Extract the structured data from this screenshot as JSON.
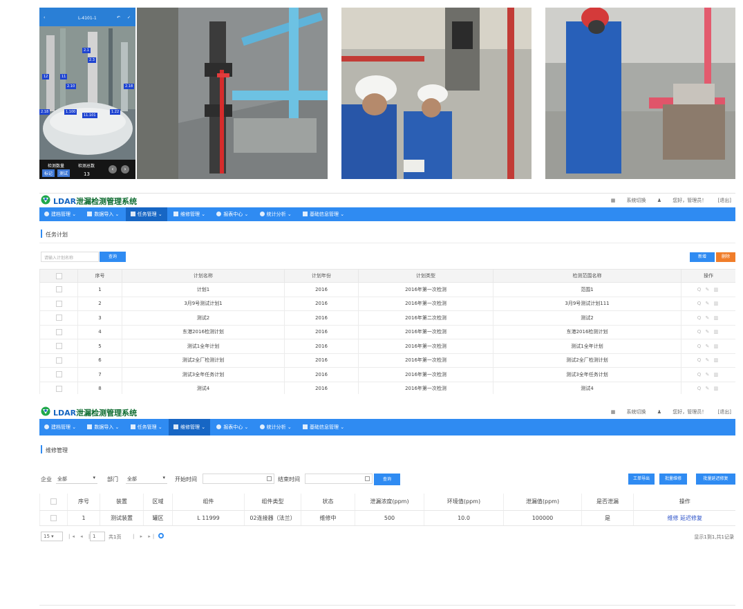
{
  "phone": {
    "title": "L-4101-1",
    "label_leak_count": "检测数量",
    "label_detected": "检测总数",
    "detected_value": "13",
    "btn_a": "标记",
    "btn_b": "测试"
  },
  "app1": {
    "brand_main": "LDAR",
    "brand_sub": "泄漏检测管理系统",
    "header_right": {
      "switch": "系统切换",
      "greeting": "您好，管理员！",
      "logout": "[退出]"
    },
    "nav": [
      "建档管理",
      "数据导入",
      "任务管理",
      "维修管理",
      "报表中心",
      "统计分析",
      "基础信息管理"
    ],
    "breadcrumb": "任务计划",
    "search_placeholder": "请输入计划名称",
    "search_button": "查询",
    "add_button": "新增",
    "delete_button": "删除",
    "columns": [
      "序号",
      "计划名称",
      "计划年份",
      "计划类型",
      "检测范围名称",
      "操作"
    ],
    "rows": [
      {
        "no": "1",
        "name": "计划1",
        "year": "2016",
        "type": "2016年第一次检测",
        "scope": "范围1"
      },
      {
        "no": "2",
        "name": "3月9号测试计划1",
        "year": "2016",
        "type": "2016年第一次检测",
        "scope": "3月9号测试计划111"
      },
      {
        "no": "3",
        "name": "测试2",
        "year": "2016",
        "type": "2016年第二次检测",
        "scope": "测试2"
      },
      {
        "no": "4",
        "name": "东港2016检测计划",
        "year": "2016",
        "type": "2016年第一次检测",
        "scope": "东港2016检测计划"
      },
      {
        "no": "5",
        "name": "测试1全年计划",
        "year": "2016",
        "type": "2016年第一次检测",
        "scope": "测试1全年计划"
      },
      {
        "no": "6",
        "name": "测试2全厂检测计划",
        "year": "2016",
        "type": "2016年第一次检测",
        "scope": "测试2全厂检测计划"
      },
      {
        "no": "7",
        "name": "测试3全年任务计划",
        "year": "2016",
        "type": "2016年第一次检测",
        "scope": "测试3全年任务计划"
      },
      {
        "no": "8",
        "name": "测试4",
        "year": "2016",
        "type": "2016年第一次检测",
        "scope": "测试4"
      }
    ],
    "ops_glyphs": "Q ✎ ▥"
  },
  "app2": {
    "brand_main": "LDAR",
    "brand_sub": "泄漏检测管理系统",
    "header_right": {
      "switch": "系统切换",
      "greeting": "您好，管理员！",
      "logout": "[退出]"
    },
    "nav": [
      "建档管理",
      "数据导入",
      "任务管理",
      "维修管理",
      "报表中心",
      "统计分析",
      "基础信息管理"
    ],
    "breadcrumb": "维修管理",
    "filters": {
      "company_label": "企业",
      "company_value": "全部",
      "dept_label": "部门",
      "dept_value": "全部",
      "start_label": "开始时间",
      "end_label": "结束时间",
      "query_button": "查询"
    },
    "right_buttons": [
      "工单导出",
      "批量维修",
      "批量延迟修复"
    ],
    "columns": [
      "",
      "序号",
      "装置",
      "区域",
      "组件",
      "组件类型",
      "状态",
      "泄漏浓度(ppm)",
      "环境值(ppm)",
      "泄漏值(ppm)",
      "是否泄漏",
      "操作"
    ],
    "rows": [
      {
        "no": "1",
        "device": "测试装置",
        "area": "罐区",
        "component": "L 11999",
        "type": "02连接器（法兰）",
        "status": "维修中",
        "leak": "500",
        "env": "10.0",
        "value": "100000",
        "is_leak": "是",
        "op_a": "维修",
        "op_b": "延迟修复"
      }
    ],
    "pager": {
      "size": "15",
      "page": "1",
      "of": "共1页",
      "summary": "显示1到1,共1记录"
    }
  }
}
